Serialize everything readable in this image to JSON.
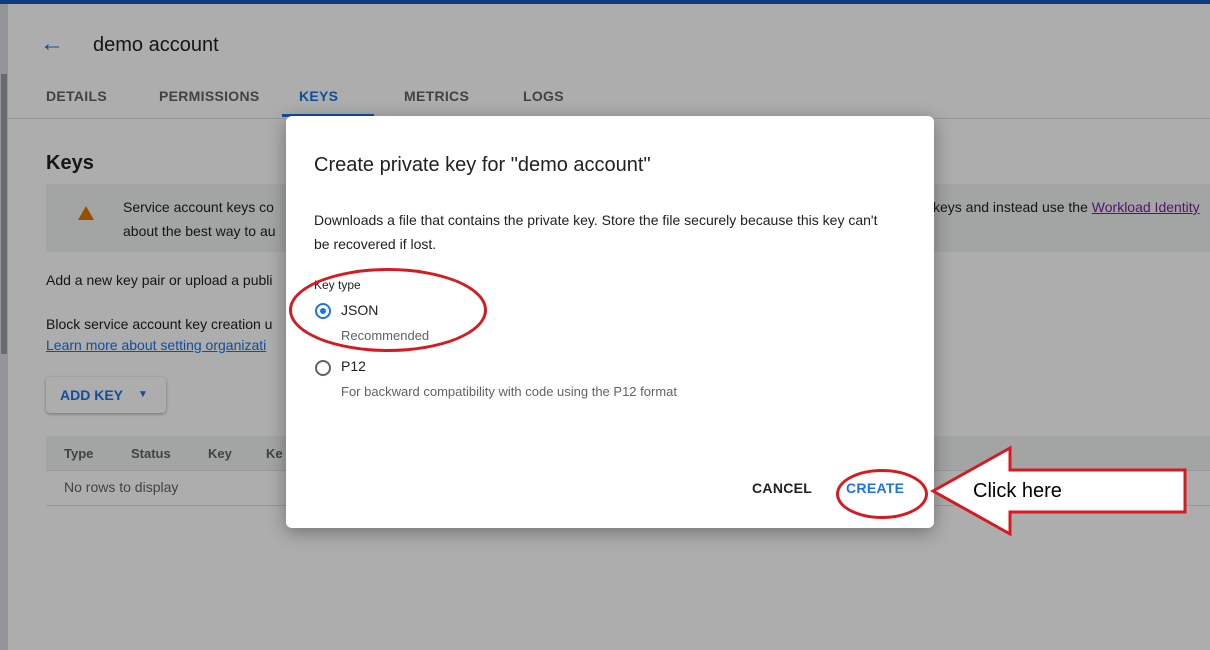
{
  "header": {
    "back_icon": "arrow-left-icon",
    "title": "demo account"
  },
  "tabs": [
    "DETAILS",
    "PERMISSIONS",
    "KEYS",
    "METRICS",
    "LOGS"
  ],
  "active_tab": "KEYS",
  "section": {
    "heading": "Keys",
    "warning_text": "Service account keys co",
    "warning_text_line2": "about the best way to au",
    "warning_text_right": "keys and instead use the ",
    "warning_link": "Workload Identity",
    "add_key_text": "Add a new key pair or upload a publi",
    "block_text": "Block service account key creation u",
    "learn_link": "Learn more about setting organizati",
    "add_key_button": "ADD KEY",
    "table_headers": [
      "Type",
      "Status",
      "Key",
      "Ke"
    ],
    "empty_message": "No rows to display"
  },
  "dialog": {
    "title": "Create private key for \"demo account\"",
    "description": "Downloads a file that contains the private key. Store the file securely because this key can't be recovered if lost.",
    "key_type_label": "Key type",
    "options": [
      {
        "label": "JSON",
        "sublabel": "Recommended",
        "selected": true
      },
      {
        "label": "P12",
        "sublabel": "For backward compatibility with code using the P12 format",
        "selected": false
      }
    ],
    "cancel_label": "CANCEL",
    "create_label": "CREATE"
  },
  "annotation": {
    "callout_text": "Click here",
    "color": "#d71920"
  },
  "colors": {
    "accent": "#1a73e8",
    "topbar": "#1a57b8",
    "warning": "#e37400"
  }
}
